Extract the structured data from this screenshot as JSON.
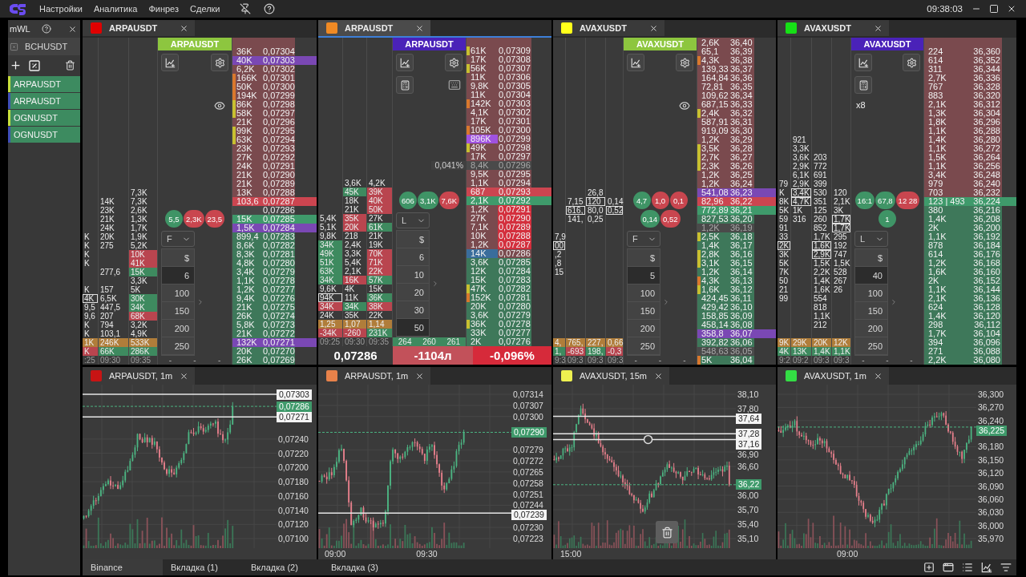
{
  "top_bar": {
    "menu": [
      "Настройки",
      "Аналитика",
      "Финрез",
      "Сделки"
    ],
    "clock": "09:38:03"
  },
  "sidebar": {
    "title": "mWL",
    "ticker": "BCHUSDT",
    "items": [
      {
        "label": "ARPAUSDT",
        "color": "#c8e03c"
      },
      {
        "label": "ARPAUSDT",
        "color": "#3f4fb8"
      },
      {
        "label": "OGNUSDT",
        "color": "#c8e03c"
      },
      {
        "label": "OGNUSDT",
        "color": "#3f4fb8"
      }
    ]
  },
  "panels": [
    {
      "tab": {
        "label": "ARPAUSDT",
        "color": "#e00000",
        "selected": false
      },
      "header": {
        "label": "ARPAUSDT",
        "color": "#8dc63f"
      },
      "tools": [
        {
          "kind": "chart"
        },
        {
          "kind": "settings"
        },
        {
          "kind": "eye"
        }
      ],
      "bubbles": [
        {
          "text": "5,5",
          "kind": "buy"
        },
        {
          "text": "2,3K",
          "kind": "sell"
        },
        {
          "text": "23,5",
          "kind": "sell"
        }
      ],
      "mode": "F",
      "sizes": [
        {
          "label": "$",
          "selected": false
        },
        {
          "label": "6",
          "selected": true
        },
        {
          "label": "100",
          "selected": false
        },
        {
          "label": "150",
          "selected": false
        },
        {
          "label": "200",
          "selected": false
        },
        {
          "label": "250",
          "selected": false
        }
      ],
      "marks": {
        "values": [
          "-",
          "-",
          "-"
        ],
        "highlighted": false
      },
      "cluster": {
        "totals": [
          "1K",
          "246K",
          "533K"
        ],
        "net": [
          {
            "text": "K",
            "kind": "sell"
          },
          {
            "text": "66K",
            "kind": "buy"
          },
          {
            "text": "286K",
            "kind": "buy"
          }
        ],
        "times": [
          ":25",
          "09:30",
          "09:35"
        ]
      },
      "ladder": [
        {
          "vol": "36K",
          "price": "0,07304",
          "kind": "ask"
        },
        {
          "vol": "40K",
          "price": "0,07303",
          "kind": "ask-band",
          "color": "#7a48b4"
        },
        {
          "vol": "6,2K",
          "price": "0,07302",
          "kind": "ask"
        },
        {
          "vol": "166K",
          "price": "0,07301",
          "kind": "ask-marker",
          "color": "#d9782d"
        },
        {
          "vol": "50K",
          "price": "0,07300",
          "kind": "ask-marker",
          "color": "#d9782d"
        },
        {
          "vol": "194K",
          "price": "0,07299",
          "kind": "ask-marker",
          "color": "#d9782d"
        },
        {
          "vol": "86K",
          "price": "0,07298",
          "kind": "ask-marker",
          "color": "#c8c030"
        },
        {
          "vol": "58K",
          "price": "0,07297",
          "kind": "ask-marker",
          "color": "#c8c030"
        },
        {
          "vol": "21K",
          "price": "0,07296",
          "kind": "ask"
        },
        {
          "vol": "99K",
          "price": "0,07295",
          "kind": "ask-marker",
          "color": "#c8c030"
        },
        {
          "vol": "63K",
          "price": "0,07294",
          "kind": "ask-marker",
          "color": "#c8c030"
        },
        {
          "vol": "23K",
          "price": "0,07293",
          "kind": "ask"
        },
        {
          "vol": "27K",
          "price": "0,07292",
          "kind": "ask"
        },
        {
          "vol": "24K",
          "price": "0,07291",
          "kind": "ask"
        },
        {
          "vol": "21K",
          "price": "0,07290",
          "kind": "ask"
        },
        {
          "vol": "21K",
          "price": "0,07289",
          "kind": "ask"
        },
        {
          "vol": "13K",
          "price": "0,07288",
          "kind": "ask",
          "cells": [
            null,
            null,
            "7,3K"
          ]
        },
        {
          "vol": "103,6",
          "price": "0,07287",
          "kind": "ask-best",
          "cells": [
            null,
            "14K",
            "7,3K"
          ]
        },
        {
          "price": "0,07286",
          "kind": "spread",
          "cells": [
            null,
            "23K",
            "2,6K"
          ]
        },
        {
          "vol": "15K",
          "price": "0,07285",
          "kind": "bid-best",
          "cells": [
            null,
            "21K",
            "1,3K"
          ]
        },
        {
          "vol": "1,5K",
          "price": "0,07284",
          "kind": "bid-band",
          "color": "#7a48b4",
          "cells": [
            null,
            "24K",
            "1,7K"
          ]
        },
        {
          "vol": "899,4",
          "price": "0,07283",
          "kind": "bid",
          "cells": [
            "K",
            "20K",
            "1,9K"
          ]
        },
        {
          "vol": "8,6K",
          "price": "0,07282",
          "kind": "bid",
          "cells": [
            "K",
            "275",
            "5,2K"
          ]
        },
        {
          "vol": "8,3K",
          "price": "0,07281",
          "kind": "bid",
          "cells": [
            "K",
            null,
            {
              "text": "10K",
              "kind": "sell"
            }
          ]
        },
        {
          "vol": "4,8K",
          "price": "0,07280",
          "kind": "bid",
          "cells": [
            "K",
            null,
            {
              "text": "41K",
              "kind": "sell"
            }
          ]
        },
        {
          "vol": "3,4K",
          "price": "0,07279",
          "kind": "bid",
          "cells": [
            null,
            "277,6",
            {
              "text": "15K",
              "kind": "buy"
            }
          ]
        },
        {
          "vol": "1,1K",
          "price": "0,07278",
          "kind": "bid",
          "cells": [
            null,
            null,
            "3,3K"
          ]
        },
        {
          "vol": "1,2K",
          "price": "0,07277",
          "kind": "bid",
          "cells": [
            "K",
            "157",
            "5K"
          ]
        },
        {
          "vol": "9,4K",
          "price": "0,07276",
          "kind": "bid",
          "cells": [
            {
              "text": "4K",
              "kind": "box"
            },
            "6,5K",
            {
              "text": "30K",
              "kind": "buy"
            }
          ]
        },
        {
          "vol": "21K",
          "price": "0,07275",
          "kind": "bid",
          "cells": [
            "9,5",
            "447,5",
            {
              "text": "34K",
              "kind": "buy"
            }
          ]
        },
        {
          "vol": "26K",
          "price": "0,07274",
          "kind": "bid",
          "cells": [
            "9,6",
            "207",
            {
              "text": "68K",
              "kind": "sell"
            }
          ]
        },
        {
          "vol": "5,8K",
          "price": "0,07273",
          "kind": "bid",
          "cells": [
            "K",
            "794",
            "3,2K"
          ]
        },
        {
          "vol": "21K",
          "price": "0,07272",
          "kind": "bid",
          "cells": [
            "K",
            "103,1",
            "4,9K"
          ]
        },
        {
          "vol": "132K",
          "price": "0,07271",
          "kind": "bid-band",
          "color": "#7a48b4"
        },
        {
          "vol": "20K",
          "price": "0,07270",
          "kind": "bid"
        },
        {
          "vol": "26K",
          "price": "0,07269",
          "kind": "bid"
        }
      ]
    },
    {
      "tab": {
        "label": "ARPAUSDT",
        "color": "#f08a24",
        "selected": true
      },
      "header": {
        "label": "ARPAUSDT",
        "color": "#4a22b8"
      },
      "tools": [
        {
          "kind": "chart"
        },
        {
          "kind": "settings"
        },
        {
          "kind": "calculator"
        },
        {
          "kind": "keyboard"
        }
      ],
      "bubbles": [
        {
          "text": "606",
          "kind": "buy"
        },
        {
          "text": "3,1K",
          "kind": "buy"
        },
        {
          "text": "7,6K",
          "kind": "sell"
        }
      ],
      "mode": "L",
      "sizes": [
        {
          "label": "$",
          "selected": false
        },
        {
          "label": "6",
          "selected": false
        },
        {
          "label": "10",
          "selected": false
        },
        {
          "label": "20",
          "selected": false
        },
        {
          "label": "30",
          "selected": false
        },
        {
          "label": "50",
          "selected": true
        }
      ],
      "marks": {
        "values": [
          "264",
          "260",
          "261"
        ],
        "highlighted": true
      },
      "cluster": {
        "totals": [
          "1,25",
          "1,07",
          "1,14"
        ],
        "net": [
          {
            "text": "-34K",
            "kind": "sell"
          },
          {
            "text": "-260",
            "kind": "sell"
          },
          {
            "text": "231K",
            "kind": "buy"
          }
        ],
        "times": [
          "09:25",
          "09:30",
          "09:35"
        ]
      },
      "ladder": [
        {
          "vol": "61K",
          "price": "0,07309",
          "kind": "ask-marker",
          "color": "#c8c030"
        },
        {
          "vol": "17K",
          "price": "0,07308",
          "kind": "ask"
        },
        {
          "vol": "56K",
          "price": "0,07307",
          "kind": "ask-marker",
          "color": "#c8c030"
        },
        {
          "vol": "11K",
          "price": "0,07306",
          "kind": "ask"
        },
        {
          "vol": "9,8K",
          "price": "0,07305",
          "kind": "ask"
        },
        {
          "vol": "11K",
          "price": "0,07304",
          "kind": "ask"
        },
        {
          "vol": "142K",
          "price": "0,07303",
          "kind": "ask-marker",
          "color": "#d9782d"
        },
        {
          "vol": "4,1K",
          "price": "0,07302",
          "kind": "ask"
        },
        {
          "vol": "17K",
          "price": "0,07301",
          "kind": "ask"
        },
        {
          "vol": "105K",
          "price": "0,07300",
          "kind": "ask-marker",
          "color": "#d9782d"
        },
        {
          "vol": "896K",
          "price": "0,07299",
          "kind": "ask-volume",
          "color": "#a052e0"
        },
        {
          "vol": "49K",
          "price": "0,07298",
          "kind": "ask-marker",
          "color": "#c8c030"
        },
        {
          "vol": "17K",
          "price": "0,07297",
          "kind": "ask"
        },
        {
          "vol": "8,4K",
          "price": "0,07296",
          "kind": "ask-hover",
          "note": "0,041%"
        },
        {
          "vol": "9,5K",
          "price": "0,07295",
          "kind": "ask"
        },
        {
          "vol": "1,1K",
          "price": "0,07294",
          "kind": "ask",
          "cells": [
            null,
            "3,6K",
            "4,2K"
          ]
        },
        {
          "vol": "687",
          "price": "0,07293",
          "kind": "ask-best",
          "cells": [
            null,
            {
              "text": "45K",
              "kind": "buy"
            },
            {
              "text": "39K",
              "kind": "sell"
            }
          ]
        },
        {
          "vol": "2,1K",
          "price": "0,07292",
          "kind": "bid-best",
          "cells": [
            null,
            "18K",
            {
              "text": "40K",
              "kind": "sell"
            }
          ]
        },
        {
          "vol": "1,2K",
          "price": "0,07291",
          "kind": "ask-hot",
          "cells": [
            null,
            "21K",
            {
              "text": "50K",
              "kind": "sell"
            }
          ]
        },
        {
          "vol": "27K",
          "price": "0,07290",
          "kind": "ask-hot",
          "cells": [
            "5,4K",
            {
              "text": "35K",
              "kind": "sell"
            },
            "27K"
          ]
        },
        {
          "vol": "7,1K",
          "price": "0,07289",
          "kind": "ask-hot",
          "cells": [
            "5,1K",
            {
              "text": "20K",
              "kind": "sell"
            },
            {
              "text": "61K",
              "kind": "buy"
            }
          ]
        },
        {
          "vol": "10K",
          "price": "0,07288",
          "kind": "ask-hot",
          "cells": [
            "9,8K",
            "218",
            "21K"
          ]
        },
        {
          "vol": "1,2K",
          "price": "0,07287",
          "kind": "ask-hot",
          "cells": [
            {
              "text": "34K",
              "kind": "buy"
            },
            "2,4K",
            "19K"
          ]
        },
        {
          "vol": "14K",
          "price": "0,07286",
          "kind": "ask-volume",
          "color": "#3a6d9c",
          "cells": [
            {
              "text": "49K",
              "kind": "buy"
            },
            "3,3K",
            {
              "text": "70K",
              "kind": "sell"
            }
          ]
        },
        {
          "vol": "3,6K",
          "price": "0,07285",
          "kind": "bid",
          "cells": [
            {
              "text": "51K",
              "kind": "buy"
            },
            "5,4K",
            {
              "text": "71K",
              "kind": "sell"
            }
          ]
        },
        {
          "vol": "12K",
          "price": "0,07284",
          "kind": "bid",
          "cells": [
            {
              "text": "63K",
              "kind": "buy"
            },
            "2,1K",
            {
              "text": "22K",
              "kind": "sell"
            }
          ]
        },
        {
          "vol": "15K",
          "price": "0,07283",
          "kind": "bid",
          "cells": [
            {
              "text": "34K",
              "kind": "buy"
            },
            {
              "text": "16K",
              "kind": "sell"
            },
            {
              "text": "57K",
              "kind": "buy"
            }
          ]
        },
        {
          "vol": "47K",
          "price": "0,07282",
          "kind": "bid-marker",
          "color": "#c8c030",
          "cells": [
            "9,6K",
            "4K",
            "15K"
          ]
        },
        {
          "vol": "152K",
          "price": "0,07281",
          "kind": "bid-marker",
          "color": "#d9782d",
          "cells": [
            {
              "text": "94K",
              "kind": "box"
            },
            "11K",
            {
              "text": "36K",
              "kind": "buy"
            }
          ]
        },
        {
          "vol": "20K",
          "price": "0,07280",
          "kind": "bid",
          "cells": [
            {
              "text": "34K",
              "kind": "sell"
            },
            {
              "text": "34K",
              "kind": "buy"
            },
            {
              "text": "38K",
              "kind": "sell"
            }
          ]
        },
        {
          "vol": "3,6K",
          "price": "0,07279",
          "kind": "bid",
          "cells": [
            "24K",
            "35K",
            "22K"
          ]
        },
        {
          "vol": "36K",
          "price": "0,07278",
          "kind": "bid-marker",
          "color": "#c8c030"
        },
        {
          "vol": "33K",
          "price": "0,07277",
          "kind": "bid"
        },
        {
          "vol": "2K",
          "price": "0,07276",
          "kind": "bid"
        }
      ],
      "footer": {
        "price": "0,07286",
        "delta": "-1104л",
        "change": "-0,096%"
      }
    },
    {
      "tab": {
        "label": "AVAXUSDT",
        "color": "#ffff1a",
        "selected": false
      },
      "header": {
        "label": "AVAXUSDT",
        "color": "#8dc63f"
      },
      "tools": [
        {
          "kind": "chart"
        },
        {
          "kind": "settings"
        },
        {
          "kind": "eye"
        }
      ],
      "bubbles": [
        {
          "text": "4,7",
          "kind": "buy"
        },
        {
          "text": "1,0",
          "kind": "sell"
        },
        {
          "text": "0,1",
          "kind": "sell"
        },
        {
          "text": "0,14",
          "kind": "buy"
        },
        {
          "text": "0,52",
          "kind": "sell"
        }
      ],
      "mode": "F",
      "sizes": [
        {
          "label": "$",
          "selected": false
        },
        {
          "label": "5",
          "selected": true
        },
        {
          "label": "100",
          "selected": false
        },
        {
          "label": "150",
          "selected": false
        },
        {
          "label": "200",
          "selected": false
        },
        {
          "label": "250",
          "selected": false
        }
      ],
      "marks": {
        "values": [
          "-",
          "-",
          "-"
        ],
        "highlighted": false
      },
      "cluster": {
        "totals": [
          "4,",
          "765,",
          "227,",
          "0,66"
        ],
        "net": [
          {
            "text": "1,",
            "kind": "buy"
          },
          {
            "text": "-693",
            "kind": "sell"
          },
          {
            "text": "198,",
            "kind": "buy"
          },
          {
            "text": "-0,3",
            "kind": "sell"
          }
        ],
        "times": [
          "9:3",
          "09:3",
          "09:3",
          "09:3"
        ]
      },
      "ladder": [
        {
          "vol": "2,6K",
          "price": "36,40",
          "kind": "ask"
        },
        {
          "vol": "65,1",
          "price": "36,39",
          "kind": "ask"
        },
        {
          "vol": "4,3K",
          "price": "36,38",
          "kind": "ask-marker",
          "color": "#d9782d"
        },
        {
          "vol": "139,33",
          "price": "36,37",
          "kind": "ask"
        },
        {
          "vol": "164,84",
          "price": "36,36",
          "kind": "ask"
        },
        {
          "vol": "72,81",
          "price": "36,35",
          "kind": "ask"
        },
        {
          "vol": "109,62",
          "price": "36,34",
          "kind": "ask"
        },
        {
          "vol": "687,15",
          "price": "36,33",
          "kind": "ask"
        },
        {
          "vol": "2,4K",
          "price": "36,32",
          "kind": "ask-marker",
          "color": "#c8c030"
        },
        {
          "vol": "587,91",
          "price": "36,31",
          "kind": "ask"
        },
        {
          "vol": "919,09",
          "price": "36,30",
          "kind": "ask"
        },
        {
          "vol": "1,2K",
          "price": "36,29",
          "kind": "ask"
        },
        {
          "vol": "3,5K",
          "price": "36,28",
          "kind": "ask-marker",
          "color": "#c8c030"
        },
        {
          "vol": "2,7K",
          "price": "36,27",
          "kind": "ask-marker",
          "color": "#c8c030"
        },
        {
          "vol": "2,3K",
          "price": "36,26",
          "kind": "ask-marker",
          "color": "#c8c030"
        },
        {
          "vol": "1,2K",
          "price": "36,25",
          "kind": "ask"
        },
        {
          "vol": "1,2K",
          "price": "36,24",
          "kind": "ask"
        },
        {
          "vol": "541,08",
          "price": "36,23",
          "kind": "ask-band",
          "color": "#7a48b4",
          "cells": [
            null,
            null,
            "26,8",
            null
          ]
        },
        {
          "vol": "82,96",
          "price": "36,22",
          "kind": "ask-best",
          "cells": [
            null,
            "7,15",
            {
              "text": "120",
              "kind": "box"
            },
            "0,14"
          ]
        },
        {
          "vol": "772,89",
          "price": "36,21",
          "kind": "bid-best",
          "cells": [
            null,
            {
              "text": "616,",
              "kind": "box"
            },
            "80,0",
            {
              "text": "0,52",
              "kind": "box"
            }
          ]
        },
        {
          "vol": "827,53",
          "price": "36,20",
          "kind": "bid",
          "cells": [
            null,
            "141,",
            "0,25",
            null
          ]
        },
        {
          "vol": "1,2K",
          "price": "36,19",
          "kind": "bid-hover"
        },
        {
          "vol": "2,5K",
          "price": "36,18",
          "kind": "bid-marker",
          "color": "#c8c030",
          "cells": [
            "7,9",
            null,
            null,
            null
          ]
        },
        {
          "vol": "1,4K",
          "price": "36,17",
          "kind": "bid",
          "cells": [
            {
              "text": "00",
              "kind": "box"
            },
            null,
            null,
            null
          ]
        },
        {
          "vol": "2,8K",
          "price": "36,16",
          "kind": "bid-marker",
          "color": "#c8c030",
          "cells": [
            ",2",
            null,
            null,
            null
          ]
        },
        {
          "vol": "3,1K",
          "price": "36,15",
          "kind": "bid-marker",
          "color": "#c8c030",
          "cells": [
            ",8",
            null,
            null,
            null
          ]
        },
        {
          "vol": "1,2K",
          "price": "36,14",
          "kind": "bid",
          "cells": [
            "15",
            null,
            null,
            null
          ]
        },
        {
          "vol": "4,3K",
          "price": "36,13",
          "kind": "bid-marker",
          "color": "#d9782d"
        },
        {
          "vol": "1,6K",
          "price": "36,12",
          "kind": "bid-marker",
          "color": "#c8c030"
        },
        {
          "vol": "424,45",
          "price": "36,11",
          "kind": "bid"
        },
        {
          "vol": "429,42",
          "price": "36,10",
          "kind": "bid"
        },
        {
          "vol": "158,85",
          "price": "36,09",
          "kind": "bid"
        },
        {
          "vol": "458,14",
          "price": "36,08",
          "kind": "bid"
        },
        {
          "vol": "358,8",
          "price": "36,07",
          "kind": "bid-band",
          "color": "#7a48b4"
        },
        {
          "vol": "392,82",
          "price": "36,06",
          "kind": "bid"
        },
        {
          "vol": "548,63",
          "price": "36,05",
          "kind": "bid-hover"
        },
        {
          "vol": "5K",
          "price": "36,04",
          "kind": "bid-marker",
          "color": "#d9782d"
        }
      ]
    },
    {
      "tab": {
        "label": "AVAXUSDT",
        "color": "#16e016",
        "selected": false
      },
      "header": {
        "label": "AVAXUSDT",
        "color": "#4a22b8"
      },
      "tools": [
        {
          "kind": "chart"
        },
        {
          "kind": "settings"
        },
        {
          "kind": "calculator"
        }
      ],
      "multiplier": "x8",
      "bubbles": [
        {
          "text": "16:1",
          "kind": "buy"
        },
        {
          "text": "67,8",
          "kind": "buy"
        },
        {
          "text": "12 28",
          "kind": "sell"
        },
        {
          "text": "1",
          "kind": "buy"
        }
      ],
      "mode": "L",
      "sizes": [
        {
          "label": "$",
          "selected": false
        },
        {
          "label": "40",
          "selected": true
        },
        {
          "label": "100",
          "selected": false
        },
        {
          "label": "150",
          "selected": false
        },
        {
          "label": "200",
          "selected": false
        },
        {
          "label": "250",
          "selected": false
        }
      ],
      "marks": {
        "values": [
          "-",
          "-",
          "-"
        ],
        "highlighted": false
      },
      "cluster": {
        "totals": [
          "9K",
          "29K",
          "20K",
          "12K"
        ],
        "net": [
          {
            "text": "4K",
            "kind": "buy"
          },
          {
            "text": "13K",
            "kind": "buy"
          },
          {
            "text": "1,4K",
            "kind": "buy"
          },
          {
            "text": "1,1K",
            "kind": "buy"
          }
        ],
        "times": [
          "9:2",
          "09:2",
          "09:3",
          "09:3"
        ]
      },
      "ladder": [
        {
          "vol": "224",
          "price": "36,360",
          "kind": "ask"
        },
        {
          "vol": "614",
          "price": "36,352",
          "kind": "ask"
        },
        {
          "vol": "311",
          "price": "36,344",
          "kind": "ask"
        },
        {
          "vol": "2,7K",
          "price": "36,336",
          "kind": "ask"
        },
        {
          "vol": "767",
          "price": "36,328",
          "kind": "ask"
        },
        {
          "vol": "883",
          "price": "36,320",
          "kind": "ask"
        },
        {
          "vol": "2,1K",
          "price": "36,312",
          "kind": "ask"
        },
        {
          "vol": "1,3K",
          "price": "36,304",
          "kind": "ask"
        },
        {
          "vol": "1,8K",
          "price": "36,296",
          "kind": "ask"
        },
        {
          "vol": "1,1K",
          "price": "36,288",
          "kind": "ask"
        },
        {
          "vol": "1,4K",
          "price": "36,280",
          "kind": "ask",
          "cells": [
            null,
            "921",
            null,
            null
          ]
        },
        {
          "vol": "1,1K",
          "price": "36,272",
          "kind": "ask",
          "cells": [
            null,
            "3,3K",
            null,
            null
          ]
        },
        {
          "vol": "1,5K",
          "price": "36,264",
          "kind": "ask",
          "cells": [
            null,
            "3,6K",
            "203",
            null
          ]
        },
        {
          "vol": "1,1K",
          "price": "36,256",
          "kind": "ask",
          "cells": [
            null,
            "2,9K",
            "772",
            null
          ]
        },
        {
          "vol": "3,4K",
          "price": "36,248",
          "kind": "ask",
          "cells": [
            null,
            "6,1K",
            "691",
            null
          ]
        },
        {
          "vol": "979",
          "price": "36,240",
          "kind": "ask",
          "cells": [
            "79",
            "2,9K",
            "399",
            null
          ]
        },
        {
          "vol": "703",
          "price": "36,232",
          "kind": "ask",
          "cells": [
            "K",
            {
              "text": "3,4K",
              "kind": "box"
            },
            "530",
            "120"
          ]
        },
        {
          "vol": "123 | 493",
          "price": "36,224",
          "kind": "bid-best",
          "cells": [
            "8K",
            {
              "text": "4,7K",
              "kind": "box"
            },
            "351",
            "2,1K"
          ]
        },
        {
          "vol": "380",
          "price": "36,216",
          "kind": "bid",
          "cells": [
            "5K",
            "1K",
            "125",
            "3K"
          ]
        },
        {
          "vol": "1,4K",
          "price": "36,208",
          "kind": "bid",
          "cells": [
            "59",
            "316",
            "260",
            {
              "text": "1,7K",
              "kind": "box"
            }
          ]
        },
        {
          "vol": "2K",
          "price": "36,200",
          "kind": "bid",
          "cells": [
            "91",
            null,
            "852",
            {
              "text": "1,7K",
              "kind": "box"
            }
          ]
        },
        {
          "vol": "1,1K",
          "price": "36,192",
          "kind": "bid",
          "cells": [
            "33",
            null,
            "1,7K",
            "295"
          ]
        },
        {
          "vol": "878",
          "price": "36,184",
          "kind": "bid",
          "cells": [
            {
              "text": "2K",
              "kind": "box"
            },
            null,
            {
              "text": "1,6K",
              "kind": "box"
            },
            "192"
          ]
        },
        {
          "vol": "614",
          "price": "36,176",
          "kind": "bid",
          "cells": [
            "3K",
            null,
            {
              "text": "2,9K",
              "kind": "box"
            },
            "747"
          ]
        },
        {
          "vol": "1,2K",
          "price": "36,168",
          "kind": "bid",
          "cells": [
            "5K",
            null,
            "1,5K",
            "1,5K"
          ]
        },
        {
          "vol": "1,6K",
          "price": "36,160",
          "kind": "bid",
          "cells": [
            "7K",
            null,
            "2,2K",
            "528"
          ]
        },
        {
          "vol": "2K",
          "price": "36,152",
          "kind": "bid",
          "cells": [
            "50",
            null,
            "1,4K",
            "267"
          ]
        },
        {
          "vol": "1,1K",
          "price": "36,144",
          "kind": "bid",
          "cells": [
            "21",
            null,
            "1,6K",
            "26"
          ]
        },
        {
          "vol": "2,1K",
          "price": "36,136",
          "kind": "bid",
          "cells": [
            "99",
            null,
            "554",
            null
          ]
        },
        {
          "vol": "624",
          "price": "36,128",
          "kind": "bid",
          "cells": [
            null,
            null,
            "818",
            null
          ]
        },
        {
          "vol": "1,4K",
          "price": "36,120",
          "kind": "bid",
          "cells": [
            null,
            null,
            "1,1K",
            null
          ]
        },
        {
          "vol": "298",
          "price": "36,112",
          "kind": "bid",
          "cells": [
            null,
            null,
            "212",
            null
          ]
        },
        {
          "vol": "1,7K",
          "price": "36,104",
          "kind": "bid"
        },
        {
          "vol": "394",
          "price": "36,096",
          "kind": "bid"
        },
        {
          "vol": "271",
          "price": "36,088",
          "kind": "bid"
        },
        {
          "vol": "2,2K",
          "price": "36,080",
          "kind": "bid"
        }
      ]
    }
  ],
  "charts": [
    {
      "tab": {
        "label": "ARPAUSDT, 1m",
        "color": "#c81414"
      },
      "ticks": [
        "0,07240",
        "0,07220",
        "0,07200",
        "0,07180",
        "0,07160",
        "0,07140",
        "0,07120",
        "0,07100"
      ],
      "markers": [
        {
          "text": "0,07303",
          "kind": "line",
          "handle": false
        },
        {
          "text": "0,07286",
          "kind": "last",
          "handle": false
        },
        {
          "text": "0,07271",
          "kind": "line",
          "handle": false
        }
      ]
    },
    {
      "tab": {
        "label": "ARPAUSDT, 1m",
        "color": "#e8824a"
      },
      "ticks": [
        "0,07314",
        "0,07307",
        "0,07300",
        "0,07279",
        "0,07272",
        "0,07265",
        "0,07258",
        "0,07251",
        "0,07244",
        "0,07230",
        "0,07223"
      ],
      "markers": [
        {
          "text": "0,07290",
          "kind": "last",
          "handle": false
        },
        {
          "text": "0,07239",
          "kind": "line",
          "handle": false
        }
      ],
      "times": [
        "09:00",
        "09:30"
      ]
    },
    {
      "tab": {
        "label": "AVAXUSDT, 15m",
        "color": "#eef050"
      },
      "ticks": [
        "38,10",
        "37,80",
        "36,90",
        "36,60",
        "36,00",
        "35,70",
        "35,40",
        "35,10"
      ],
      "markers": [
        {
          "text": "37,64",
          "kind": "line",
          "handle": false
        },
        {
          "text": "37,28",
          "kind": "line",
          "handle": false
        },
        {
          "text": "37,16",
          "kind": "line",
          "handle": true
        },
        {
          "text": "36,22",
          "kind": "last",
          "handle": false
        }
      ],
      "times": [
        "15:00"
      ],
      "delete_button": true
    },
    {
      "tab": {
        "label": "AVAXUSDT, 1m",
        "color": "#33dd44"
      },
      "ticks": [
        "36,300",
        "36,270",
        "36,240",
        "36,180",
        "36,150",
        "36,120",
        "36,090",
        "36,060",
        "36,030",
        "36,000",
        "35,970"
      ],
      "markers": [
        {
          "text": "36,225",
          "kind": "last",
          "handle": false
        }
      ],
      "times": [
        "09:00"
      ]
    }
  ],
  "bottom_tabs": [
    {
      "label": "Binance",
      "selected": true
    },
    {
      "label": "Вкладка (1)",
      "selected": false
    },
    {
      "label": "Вкладка (2)",
      "selected": false
    },
    {
      "label": "Вкладка (3)",
      "selected": false
    }
  ]
}
